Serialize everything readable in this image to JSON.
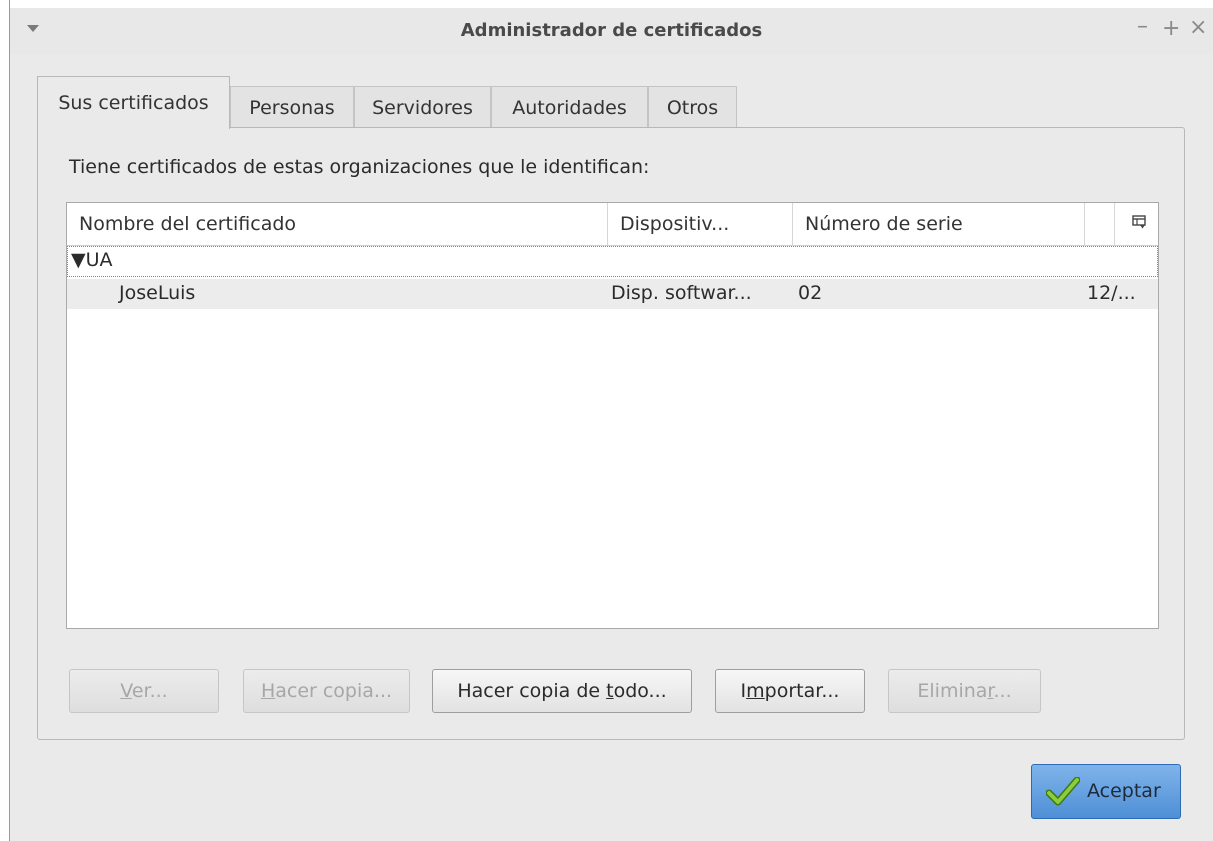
{
  "window": {
    "title": "Administrador de certificados",
    "controls": {
      "minimize": "–",
      "maximize": "+",
      "close": "×"
    }
  },
  "tabs": [
    {
      "label": "Sus certificados",
      "active": true
    },
    {
      "label": "Personas",
      "active": false
    },
    {
      "label": "Servidores",
      "active": false
    },
    {
      "label": "Autoridades",
      "active": false
    },
    {
      "label": "Otros",
      "active": false
    }
  ],
  "panel": {
    "prompt": "Tiene certificados de estas organizaciones que le identifican:"
  },
  "table": {
    "columns": [
      "Nombre del certificado",
      "Dispositiv...",
      "Número de serie"
    ],
    "groups": [
      {
        "name": "▼UA",
        "rows": [
          {
            "name": "JoseLuis",
            "device": "Disp. softwar...",
            "serial": "02",
            "expires": "12/..."
          }
        ]
      }
    ]
  },
  "buttons": {
    "view": {
      "label": "Ver...",
      "mnemonic": "V",
      "rest": "er...",
      "enabled": false
    },
    "backup": {
      "label": "Hacer copia...",
      "mnemonic": "H",
      "rest": "acer copia...",
      "enabled": false
    },
    "backup_all": {
      "pre": "Hacer copia de ",
      "mnemonic": "t",
      "rest": "odo...",
      "enabled": true
    },
    "import": {
      "pre": "I",
      "mnemonic": "m",
      "rest": "portar...",
      "enabled": true
    },
    "delete": {
      "pre": "Elimina",
      "mnemonic": "r",
      "rest": "...",
      "enabled": false
    }
  },
  "accept_button": {
    "label": "Aceptar"
  },
  "colors": {
    "accent": "#4f8fd6",
    "check_green": "#6aa82a"
  }
}
